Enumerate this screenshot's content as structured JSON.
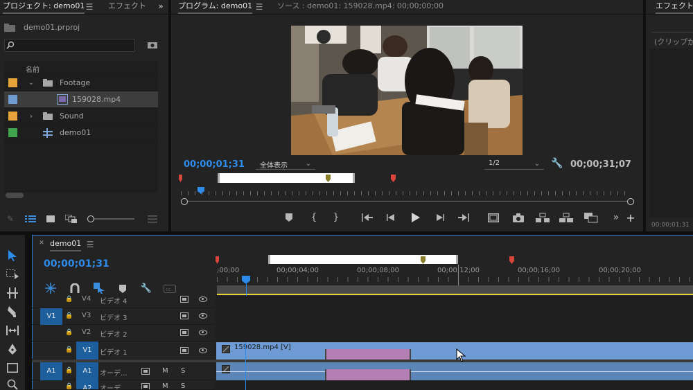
{
  "project_panel": {
    "tab_project": "プロジェクト: demo01",
    "tab_effects": "エフェクト",
    "project_file": "demo01.prproj",
    "search_placeholder": "",
    "column_name": "名前",
    "items": [
      {
        "label": "Footage",
        "color": "#e6a53a"
      },
      {
        "label": "159028.mp4",
        "color": "#6f9bd1"
      },
      {
        "label": "Sound",
        "color": "#e6a53a"
      },
      {
        "label": "demo01",
        "color": "#3fa34d"
      }
    ]
  },
  "program_monitor": {
    "tab_program": "プログラム: demo01",
    "tab_source": "ソース : demo01: 159028.mp4: 00;00;00;00",
    "current_timecode": "00;00;01;31",
    "zoom_label": "全体表示",
    "quality_label": "1/2",
    "duration_timecode": "00;00;31;07"
  },
  "effect_controls": {
    "tab": "エフェクトコ",
    "no_clip": "(クリップが",
    "timecode": "00;00;01;31"
  },
  "timeline": {
    "tab": "demo01",
    "current_timecode": "00;00;01;31",
    "ruler_labels": [
      ";00;00",
      "00;00;04;00",
      "00;00;08;00",
      "00;00;12;00",
      "00;00;16;00",
      "00;00;20;00"
    ],
    "tracks": [
      {
        "id": "V4",
        "name": "ビデオ 4"
      },
      {
        "id": "V3",
        "name": "ビデオ 3"
      },
      {
        "id": "V2",
        "name": "ビデオ 2"
      },
      {
        "id": "V1",
        "name": "ビデオ 1"
      },
      {
        "id": "A1",
        "name": "オーデ..."
      },
      {
        "id": "A2",
        "name": "オーデ..."
      }
    ],
    "source_v1": "V1",
    "source_a1": "A1",
    "mute_label": "M",
    "solo_label": "S",
    "clip_label": "159028.mp4 [V]"
  }
}
